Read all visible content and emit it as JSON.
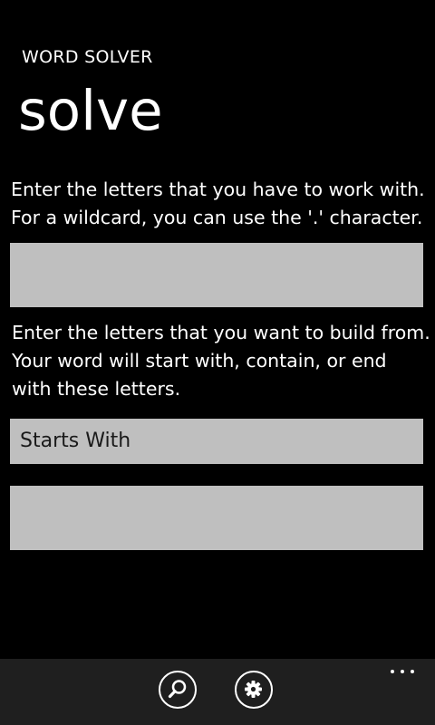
{
  "app": {
    "title": "WORD SOLVER",
    "page_title": "solve"
  },
  "instructions": {
    "letters_line1": "Enter the letters that you have to work with.",
    "letters_line2": "For a wildcard, you can use the '.' character.",
    "build_line1": "Enter the letters that you want to build from.",
    "build_line2": "Your word will start with, contain, or end",
    "build_line3": "with these letters."
  },
  "inputs": {
    "letters_value": "",
    "build_value": ""
  },
  "mode_select": {
    "selected": "Starts With"
  },
  "app_bar": {
    "buttons": [
      {
        "icon": "search-icon"
      },
      {
        "icon": "gear-icon"
      }
    ],
    "more_icon": "ellipsis-icon"
  },
  "colors": {
    "background": "#000000",
    "input_background": "#bfbfbf",
    "app_bar_background": "#1f1f1f",
    "foreground": "#ffffff"
  }
}
